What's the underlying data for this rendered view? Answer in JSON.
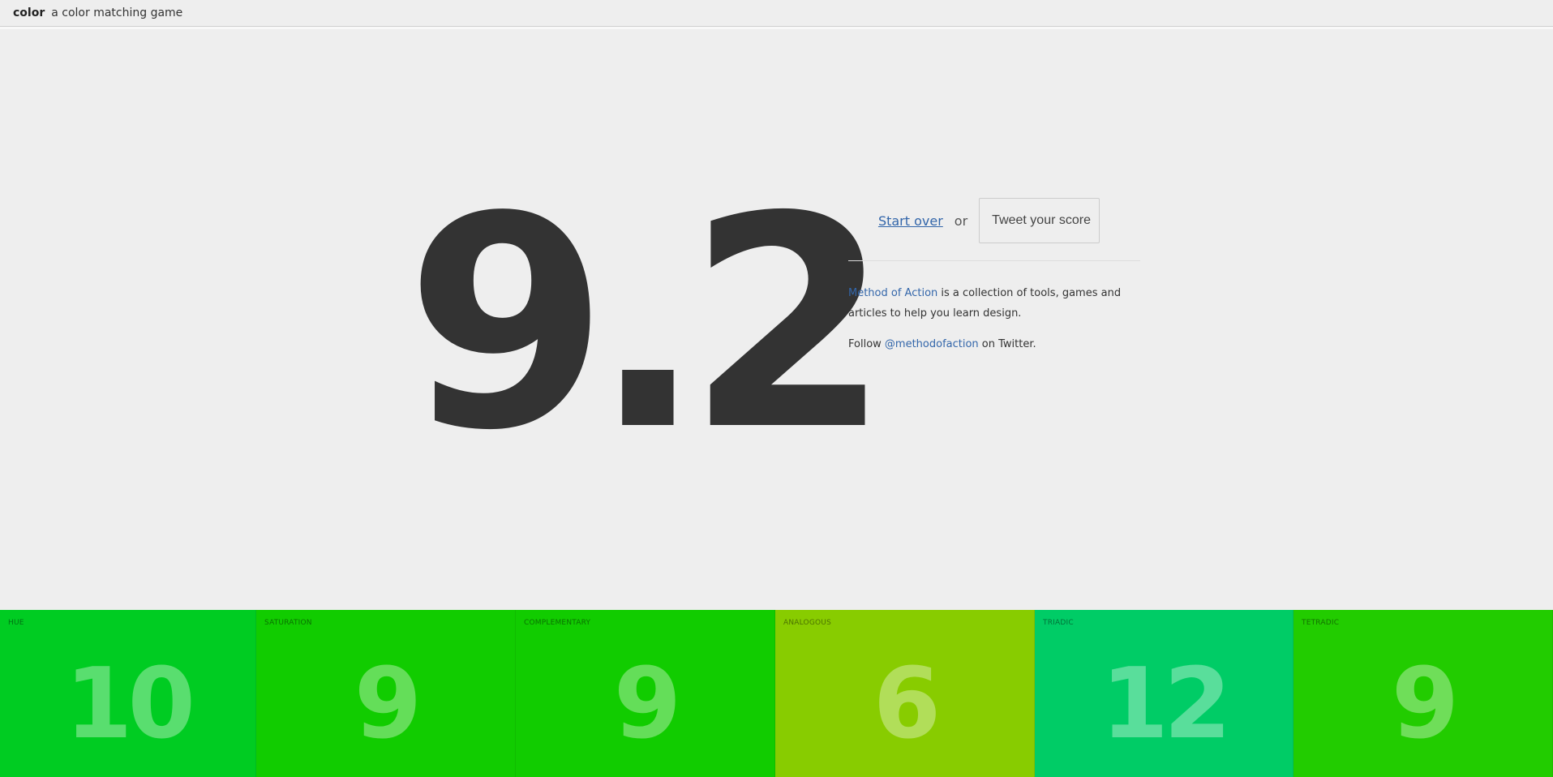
{
  "header": {
    "brand": "color",
    "tagline": "a color matching game"
  },
  "result": {
    "score": "9.2"
  },
  "actions": {
    "start_over": "Start over",
    "or": "or",
    "tweet": "Tweet your score"
  },
  "about": {
    "link": "Method of Action",
    "text": " is a collection of tools, games and articles to help you learn design."
  },
  "follow": {
    "prefix": "Follow ",
    "handle": "@methodofaction",
    "suffix": " on Twitter."
  },
  "tiles": [
    {
      "label": "HUE",
      "score": "10",
      "color": "#00cc22"
    },
    {
      "label": "SATURATION",
      "score": "9",
      "color": "#11cc00"
    },
    {
      "label": "COMPLEMENTARY",
      "score": "9",
      "color": "#11cc00"
    },
    {
      "label": "ANALOGOUS",
      "score": "6",
      "color": "#88cc00"
    },
    {
      "label": "TRIADIC",
      "score": "12",
      "color": "#00cc66"
    },
    {
      "label": "TETRADIC",
      "score": "9",
      "color": "#22cc00"
    }
  ]
}
